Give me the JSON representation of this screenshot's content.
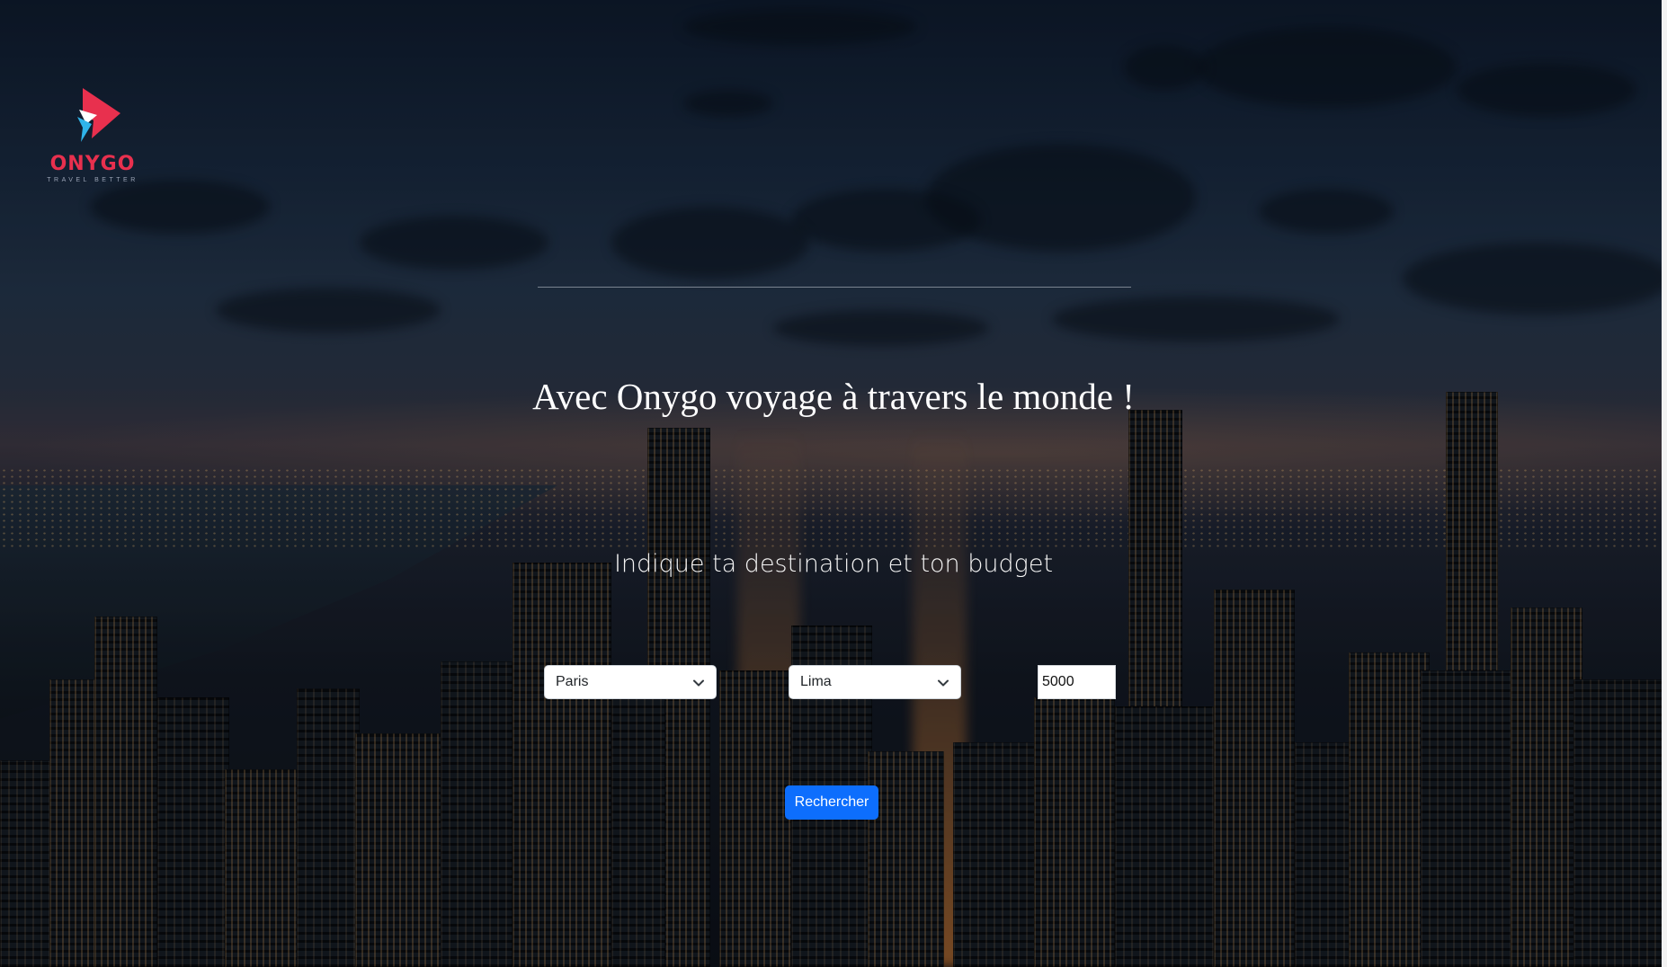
{
  "brand": {
    "name": "ONYGO",
    "tagline": "TRAVEL BETTER",
    "color": "#e8304e",
    "accent": "#2fb4e9"
  },
  "hero": {
    "headline": "Avec Onygo voyage à travers le monde !",
    "subheadline": "Indique ta destination et ton budget"
  },
  "search": {
    "origin": {
      "selected": "Paris",
      "icon": "chevron-down-icon"
    },
    "destination": {
      "selected": "Lima",
      "icon": "chevron-down-icon"
    },
    "budget": {
      "value": "5000"
    },
    "submit_label": "Rechercher",
    "submit_color": "#0d6efd"
  }
}
